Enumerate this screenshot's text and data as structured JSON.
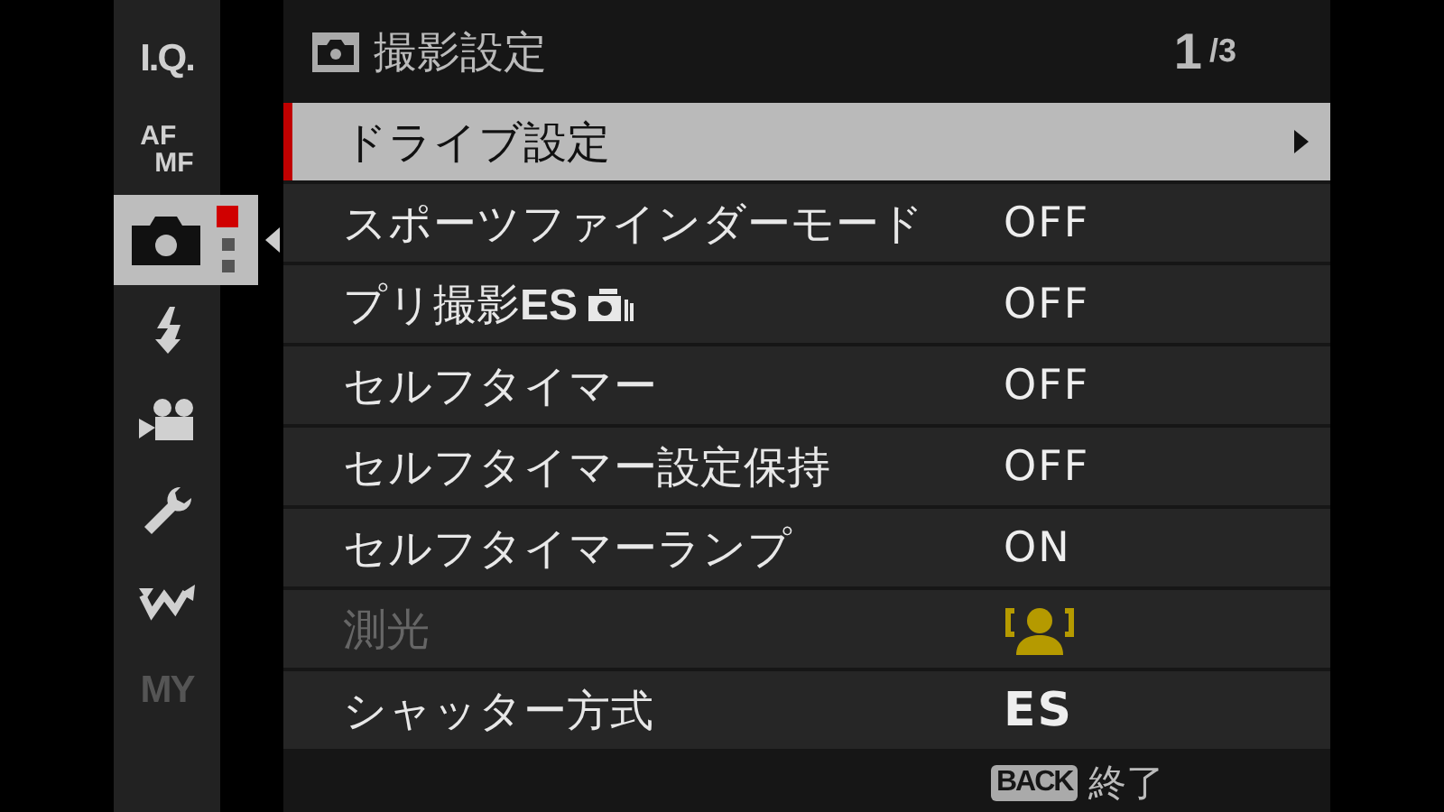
{
  "sidebar": {
    "items": [
      {
        "kind": "text",
        "label": "I.Q.",
        "selected": false,
        "disabled": false
      },
      {
        "kind": "stack",
        "label": "AF",
        "sublabel": "MF",
        "selected": false,
        "disabled": false
      },
      {
        "kind": "camera",
        "selected": true,
        "disabled": false
      },
      {
        "kind": "flash",
        "selected": false,
        "disabled": false
      },
      {
        "kind": "movie",
        "selected": false,
        "disabled": false
      },
      {
        "kind": "wrench",
        "selected": false,
        "disabled": false
      },
      {
        "kind": "connection",
        "selected": false,
        "disabled": false
      },
      {
        "kind": "text",
        "label": "MY",
        "selected": false,
        "disabled": true
      }
    ]
  },
  "header": {
    "title": "撮影設定",
    "page": "1",
    "page_total": "/3"
  },
  "rows": [
    {
      "label": "ドライブ設定",
      "selected": true,
      "disabled": false,
      "submenu": true
    },
    {
      "label": "スポーツファインダーモード",
      "selected": false,
      "disabled": false,
      "kind": "text",
      "value": "OFF"
    },
    {
      "label": "プリ撮影**ES**",
      "suffix_icon": true,
      "selected": false,
      "disabled": false,
      "kind": "text",
      "value": "OFF"
    },
    {
      "label": "セルフタイマー",
      "selected": false,
      "disabled": false,
      "kind": "text",
      "value": "OFF"
    },
    {
      "label": "セルフタイマー設定保持",
      "selected": false,
      "disabled": false,
      "kind": "text",
      "value": "OFF"
    },
    {
      "label": "セルフタイマーランプ",
      "selected": false,
      "disabled": false,
      "kind": "text",
      "value": "ON"
    },
    {
      "label": "測光",
      "selected": false,
      "disabled": true,
      "kind": "metering"
    },
    {
      "label": "シャッター方式",
      "selected": false,
      "disabled": false,
      "kind": "strong",
      "value": "ES"
    }
  ],
  "footer": {
    "key": "BACK",
    "action": "終了"
  }
}
